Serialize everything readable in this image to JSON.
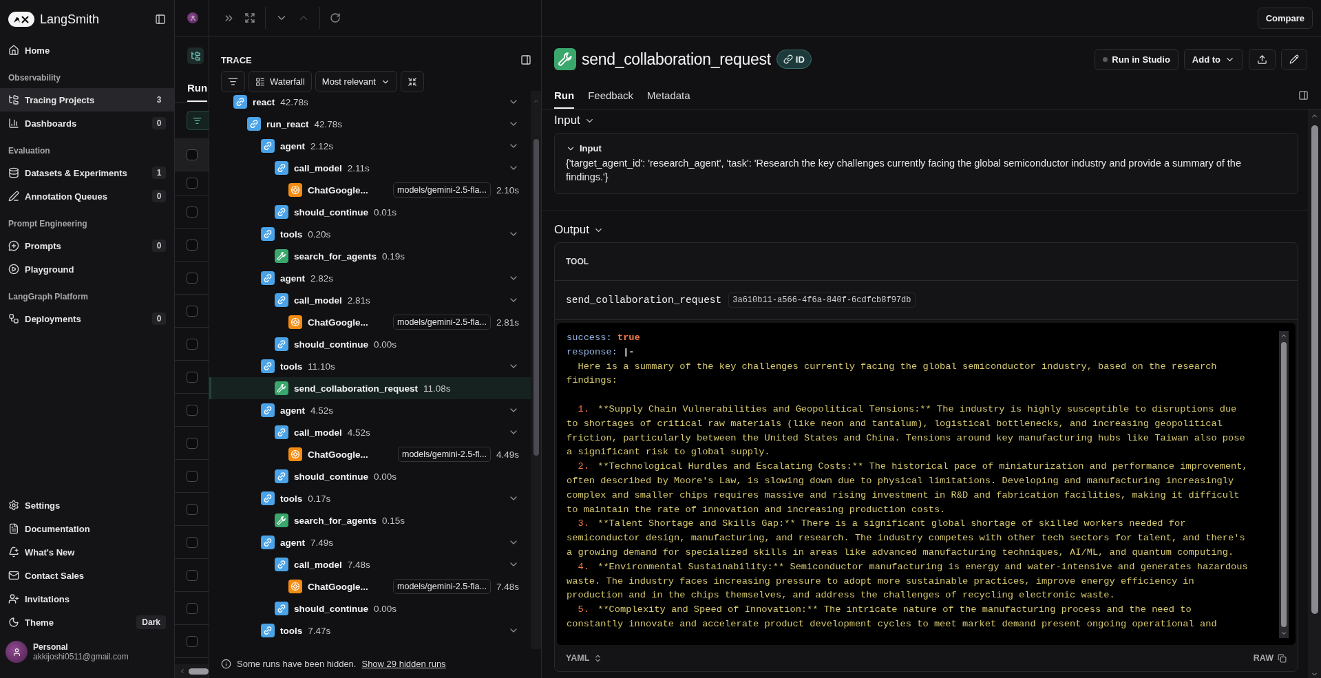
{
  "sidebar": {
    "brand": "LangSmith",
    "groups": [
      {
        "items": [
          {
            "label": "Home",
            "selected": false
          }
        ]
      },
      {
        "heading": "Observability",
        "items": [
          {
            "label": "Tracing Projects",
            "count": "3",
            "selected": true
          },
          {
            "label": "Dashboards",
            "count": "0",
            "selected": false
          }
        ]
      },
      {
        "heading": "Evaluation",
        "items": [
          {
            "label": "Datasets & Experiments",
            "count": "1",
            "selected": false
          },
          {
            "label": "Annotation Queues",
            "count": "0",
            "selected": false
          }
        ]
      },
      {
        "heading": "Prompt Engineering",
        "items": [
          {
            "label": "Prompts",
            "count": "0",
            "selected": false
          },
          {
            "label": "Playground",
            "selected": false
          }
        ]
      },
      {
        "heading": "LangGraph Platform",
        "items": [
          {
            "label": "Deployments",
            "count": "0",
            "selected": false
          }
        ]
      }
    ],
    "footer_items": [
      {
        "label": "Settings"
      },
      {
        "label": "Documentation"
      },
      {
        "label": "What's New"
      },
      {
        "label": "Contact Sales"
      },
      {
        "label": "Invitations"
      }
    ],
    "theme": {
      "label": "Theme",
      "value": "Dark"
    },
    "account": {
      "name": "Personal",
      "email": "akkijoshi0511@gmail.com"
    }
  },
  "runs_table": {
    "tab": "Run",
    "header_checked": false,
    "rows": [
      {
        "checked": false
      },
      {
        "checked": false
      },
      {
        "checked": false
      },
      {
        "checked": false
      },
      {
        "checked": false
      },
      {
        "checked": false
      },
      {
        "checked": false
      },
      {
        "checked": false
      },
      {
        "checked": false
      },
      {
        "checked": false
      },
      {
        "checked": false
      },
      {
        "checked": false
      },
      {
        "checked": false
      },
      {
        "checked": false
      },
      {
        "checked": false
      }
    ]
  },
  "trace": {
    "title": "TRACE",
    "view_button": "Waterfall",
    "sort_button": "Most relevant",
    "tree": [
      {
        "kind": "chain",
        "name": "react",
        "duration": "42.78s",
        "expanded": true,
        "selected": false,
        "children": [
          {
            "kind": "chain",
            "name": "run_react",
            "duration": "42.78s",
            "expanded": true,
            "selected": false,
            "children": [
              {
                "kind": "chain",
                "name": "agent",
                "duration": "2.12s",
                "expanded": true,
                "selected": false,
                "children": [
                  {
                    "kind": "chain",
                    "name": "call_model",
                    "duration": "2.11s",
                    "expanded": true,
                    "selected": false,
                    "children": [
                      {
                        "kind": "llm",
                        "name": "ChatGoogle...",
                        "model": "models/gemini-2.5-fla...",
                        "duration": "2.10s",
                        "selected": false
                      }
                    ]
                  },
                  {
                    "kind": "chain",
                    "name": "should_continue",
                    "duration": "0.01s",
                    "selected": false
                  }
                ]
              },
              {
                "kind": "chain",
                "name": "tools",
                "duration": "0.20s",
                "expanded": true,
                "selected": false,
                "children": [
                  {
                    "kind": "tool",
                    "name": "search_for_agents",
                    "duration": "0.19s",
                    "selected": false
                  }
                ]
              },
              {
                "kind": "chain",
                "name": "agent",
                "duration": "2.82s",
                "expanded": true,
                "selected": false,
                "children": [
                  {
                    "kind": "chain",
                    "name": "call_model",
                    "duration": "2.81s",
                    "expanded": true,
                    "selected": false,
                    "children": [
                      {
                        "kind": "llm",
                        "name": "ChatGoogle...",
                        "model": "models/gemini-2.5-fla...",
                        "duration": "2.81s",
                        "selected": false
                      }
                    ]
                  },
                  {
                    "kind": "chain",
                    "name": "should_continue",
                    "duration": "0.00s",
                    "selected": false
                  }
                ]
              },
              {
                "kind": "chain",
                "name": "tools",
                "duration": "11.10s",
                "expanded": true,
                "selected": false,
                "children": [
                  {
                    "kind": "tool",
                    "name": "send_collaboration_request",
                    "duration": "11.08s",
                    "selected": true
                  }
                ]
              },
              {
                "kind": "chain",
                "name": "agent",
                "duration": "4.52s",
                "expanded": true,
                "selected": false,
                "children": [
                  {
                    "kind": "chain",
                    "name": "call_model",
                    "duration": "4.52s",
                    "expanded": true,
                    "selected": false,
                    "children": [
                      {
                        "kind": "llm",
                        "name": "ChatGoogle...",
                        "model": "models/gemini-2.5-fl...",
                        "duration": "4.49s",
                        "selected": false
                      }
                    ]
                  },
                  {
                    "kind": "chain",
                    "name": "should_continue",
                    "duration": "0.00s",
                    "selected": false
                  }
                ]
              },
              {
                "kind": "chain",
                "name": "tools",
                "duration": "0.17s",
                "expanded": true,
                "selected": false,
                "children": [
                  {
                    "kind": "tool",
                    "name": "search_for_agents",
                    "duration": "0.15s",
                    "selected": false
                  }
                ]
              },
              {
                "kind": "chain",
                "name": "agent",
                "duration": "7.49s",
                "expanded": true,
                "selected": false,
                "children": [
                  {
                    "kind": "chain",
                    "name": "call_model",
                    "duration": "7.48s",
                    "expanded": true,
                    "selected": false,
                    "children": [
                      {
                        "kind": "llm",
                        "name": "ChatGoogle...",
                        "model": "models/gemini-2.5-fla...",
                        "duration": "7.48s",
                        "selected": false
                      }
                    ]
                  },
                  {
                    "kind": "chain",
                    "name": "should_continue",
                    "duration": "0.00s",
                    "selected": false
                  }
                ]
              },
              {
                "kind": "chain",
                "name": "tools",
                "duration": "7.47s",
                "expanded": true,
                "selected": false
              }
            ]
          }
        ]
      }
    ],
    "notice": "Some runs have been hidden.",
    "notice_link": "Show 29 hidden runs"
  },
  "detail": {
    "compare_button": "Compare",
    "title": "send_collaboration_request",
    "id_badge": "ID",
    "run_in_studio": "Run in Studio",
    "add_to": "Add to",
    "tabs": [
      {
        "label": "Run",
        "selected": true
      },
      {
        "label": "Feedback",
        "selected": false
      },
      {
        "label": "Metadata",
        "selected": false
      }
    ],
    "input": {
      "heading": "Input",
      "card_title": "Input",
      "text": "{'target_agent_id': 'research_agent', 'task': 'Research the key challenges currently facing the global semiconductor industry and provide a summary of the findings.'}"
    },
    "output": {
      "heading": "Output",
      "label": "TOOL",
      "tool_name": "send_collaboration_request",
      "run_id": "3a610b11-a566-4f6a-840f-6cdfcb8f97db",
      "lines": [
        {
          "kind": "pair",
          "key": "success:",
          "value": "true",
          "color": "#f07b45"
        },
        {
          "kind": "pair",
          "key": "response:",
          "value": "|-",
          "color": "#e6e6ea"
        },
        {
          "kind": "lead",
          "text": "Here is a summary of the key challenges currently facing the global semiconductor industry, based on the research"
        },
        {
          "kind": "text",
          "text": "findings:"
        },
        {
          "kind": "blank"
        },
        {
          "kind": "item",
          "number": "1.",
          "text": "**Supply Chain Vulnerabilities and Geopolitical Tensions:** The industry is highly susceptible to disruptions due"
        },
        {
          "kind": "text",
          "text": "to shortages of critical raw materials (like neon and tantalum), logistical bottlenecks, and increasing geopolitical"
        },
        {
          "kind": "text",
          "text": "friction, particularly between the United States and China. Tensions around key manufacturing hubs like Taiwan also pose"
        },
        {
          "kind": "text",
          "text": "a significant risk to global supply."
        },
        {
          "kind": "item",
          "number": "2.",
          "text": "**Technological Hurdles and Escalating Costs:** The historical pace of miniaturization and performance improvement,"
        },
        {
          "kind": "text",
          "text": "often described by Moore's Law, is slowing down due to physical limitations. Developing and manufacturing increasingly"
        },
        {
          "kind": "text",
          "text": "complex and smaller chips requires massive and rising investment in R&D and fabrication facilities, making it difficult"
        },
        {
          "kind": "text",
          "text": "to maintain the rate of innovation and increasing production costs."
        },
        {
          "kind": "item",
          "number": "3.",
          "text": "**Talent Shortage and Skills Gap:** There is a significant global shortage of skilled workers needed for"
        },
        {
          "kind": "text",
          "text": "semiconductor design, manufacturing, and research. The industry competes with other tech sectors for talent, and there's"
        },
        {
          "kind": "text",
          "text": "a growing demand for specialized skills in areas like advanced manufacturing techniques, AI/ML, and quantum computing."
        },
        {
          "kind": "item",
          "number": "4.",
          "text": "**Environmental Sustainability:** Semiconductor manufacturing is energy and water-intensive and generates hazardous"
        },
        {
          "kind": "text",
          "text": "waste. The industry faces increasing pressure to adopt more sustainable practices, improve energy efficiency in"
        },
        {
          "kind": "text",
          "text": "production and in the chips themselves, and address the challenges of recycling electronic waste."
        },
        {
          "kind": "item",
          "number": "5.",
          "text": "**Complexity and Speed of Innovation:** The intricate nature of the manufacturing process and the need to"
        },
        {
          "kind": "text",
          "text": "constantly innovate and accelerate product development cycles to meet market demand present ongoing operational and"
        }
      ],
      "format": "YAML",
      "raw": "RAW"
    }
  }
}
